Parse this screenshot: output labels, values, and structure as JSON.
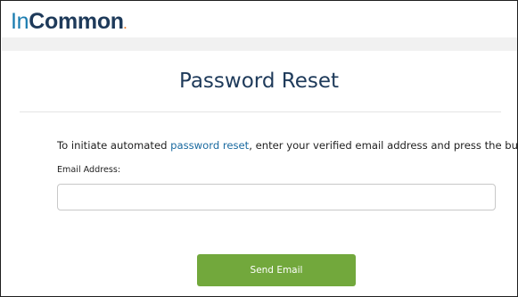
{
  "logo": {
    "part_in": "In",
    "part_common": "Common",
    "part_dot": "."
  },
  "page": {
    "title": "Password Reset"
  },
  "form": {
    "instructions_before": "To initiate automated ",
    "instructions_link": "password reset",
    "instructions_after": ", enter your verified email address and press the button.",
    "email_label": "Email Address:",
    "email_value": "",
    "email_placeholder": "",
    "submit_label": "Send Email"
  },
  "colors": {
    "brand_blue": "#1a7cb0",
    "brand_navy": "#1e3a5a",
    "brand_orange": "#e87722",
    "button_green": "#72a83c",
    "link_blue": "#1a6aa0"
  }
}
